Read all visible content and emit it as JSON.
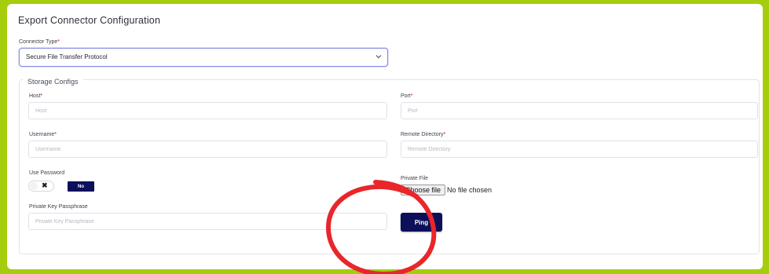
{
  "page": {
    "title": "Export Connector Configuration"
  },
  "connector": {
    "label": "Connector Type",
    "required_mark": "*",
    "selected": "Secure File Transfer Protocol"
  },
  "storage": {
    "legend": "Storage Configs",
    "host": {
      "label": "Host",
      "required_mark": "*",
      "placeholder": "Host"
    },
    "port": {
      "label": "Port",
      "required_mark": "*",
      "placeholder": "Port"
    },
    "username": {
      "label": "Username",
      "required_mark": "*",
      "placeholder": "Username"
    },
    "remote_directory": {
      "label": "Remote Directory",
      "required_mark": "*",
      "placeholder": "Remote Directory"
    },
    "use_password": {
      "label": "Use Password",
      "toggle_symbol": "✖",
      "state_badge": "No"
    },
    "private_file": {
      "label": "Private File",
      "button_label": "Choose file",
      "status": "No file chosen"
    },
    "passphrase": {
      "label": "Private Key Passphrase",
      "placeholder": "Private Key Passphrase"
    },
    "ping_label": "Ping"
  },
  "colors": {
    "frame": "#a6cd0c",
    "primary": "#0c0f5a",
    "required": "#d0021b",
    "annotation": "#e8262b"
  }
}
